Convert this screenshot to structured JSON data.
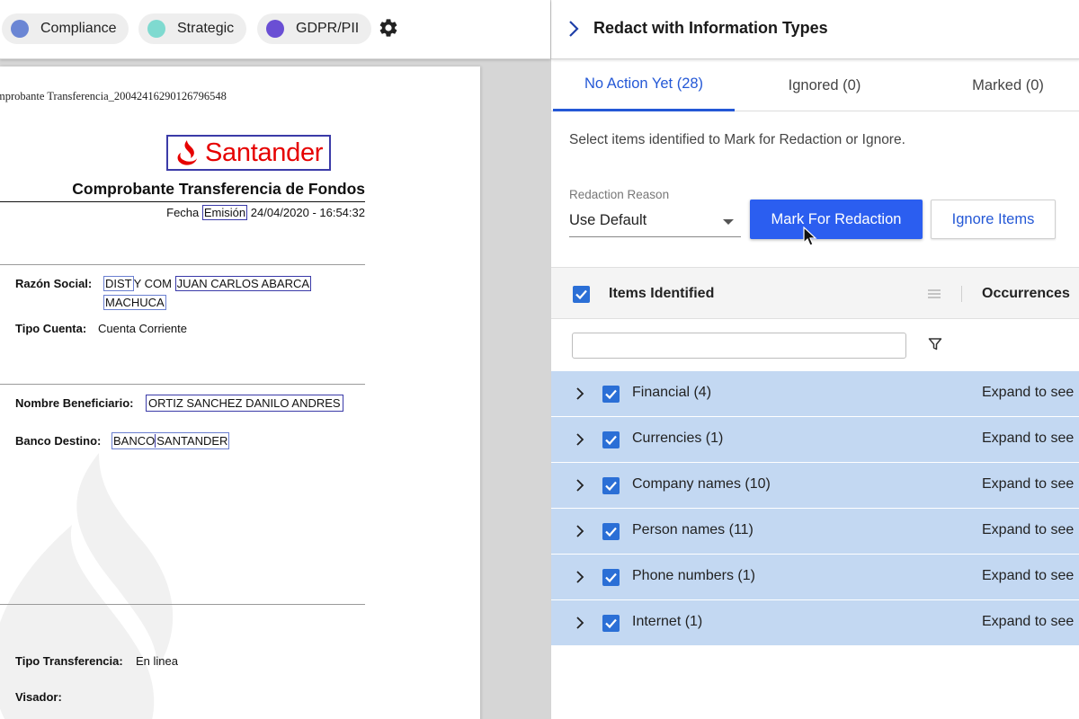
{
  "tags": [
    {
      "label": "Compliance",
      "color": "#6b86d4"
    },
    {
      "label": "Strategic",
      "color": "#7fdad0"
    },
    {
      "label": "GDPR/PII",
      "color": "#6a4fd4"
    }
  ],
  "document": {
    "filename": "mprobante Transferencia_2004241629012679654​8",
    "logo_text": "Santander",
    "title": "Comprobante Transferencia de Fondos",
    "date_prefix": "Fecha",
    "date_word": "Emisión",
    "date_value": "24/04/2020 - 16:54:32",
    "fields": {
      "razon_label": "Razón Social:",
      "razon_p1": "DIST",
      "razon_p2": "Y COM",
      "razon_p3": "JUAN CARLOS ABARCA",
      "razon_p4": "MACHUCA",
      "tipo_cuenta_label": "Tipo Cuenta:",
      "tipo_cuenta_value": "Cuenta Corriente",
      "beneficiario_label": "Nombre Beneficiario:",
      "beneficiario_value": "ORTIZ SANCHEZ DANILO ANDRES",
      "banco_label": "Banco Destino:",
      "banco_p1": "BANCO",
      "banco_p2": "SANTANDER",
      "tipo_transferencia_label": "Tipo Transferencia:",
      "tipo_transferencia_value": "En linea",
      "visador_label": "Visador:"
    }
  },
  "panel": {
    "title": "Redact with Information Types",
    "tabs": [
      {
        "label": "No Action Yet (28)",
        "active": true
      },
      {
        "label": "Ignored (0)",
        "active": false
      },
      {
        "label": "Marked (0)",
        "active": false
      }
    ],
    "instructions": "Select items identified to Mark for Redaction or Ignore.",
    "reason_label": "Redaction Reason",
    "reason_value": "Use Default",
    "mark_button": "Mark For Redaction",
    "ignore_button": "Ignore Items",
    "table": {
      "col_items": "Items Identified",
      "col_occurrences": "Occurrences",
      "filter_value": "",
      "rows": [
        {
          "label": "Financial (4)",
          "occurrences": "Expand to see"
        },
        {
          "label": "Currencies (1)",
          "occurrences": "Expand to see"
        },
        {
          "label": "Company names (10)",
          "occurrences": "Expand to see"
        },
        {
          "label": "Person names (11)",
          "occurrences": "Expand to see"
        },
        {
          "label": "Phone numbers (1)",
          "occurrences": "Expand to see"
        },
        {
          "label": "Internet (1)",
          "occurrences": "Expand to see"
        }
      ]
    }
  },
  "colors": {
    "accent": "#2458d6",
    "primary_button": "#2b5ef0",
    "row_highlight": "#c3d8f2",
    "santander_red": "#e60000",
    "redaction_box": "#3a3aa8"
  },
  "icons": {
    "settings": "gear-icon",
    "panel_toggle": "chevron-right-icon",
    "filter": "filter-icon",
    "row_expand": "chevron-right-icon",
    "checkbox": "checkbox-checked-icon",
    "cursor": "mouse-pointer-icon"
  }
}
